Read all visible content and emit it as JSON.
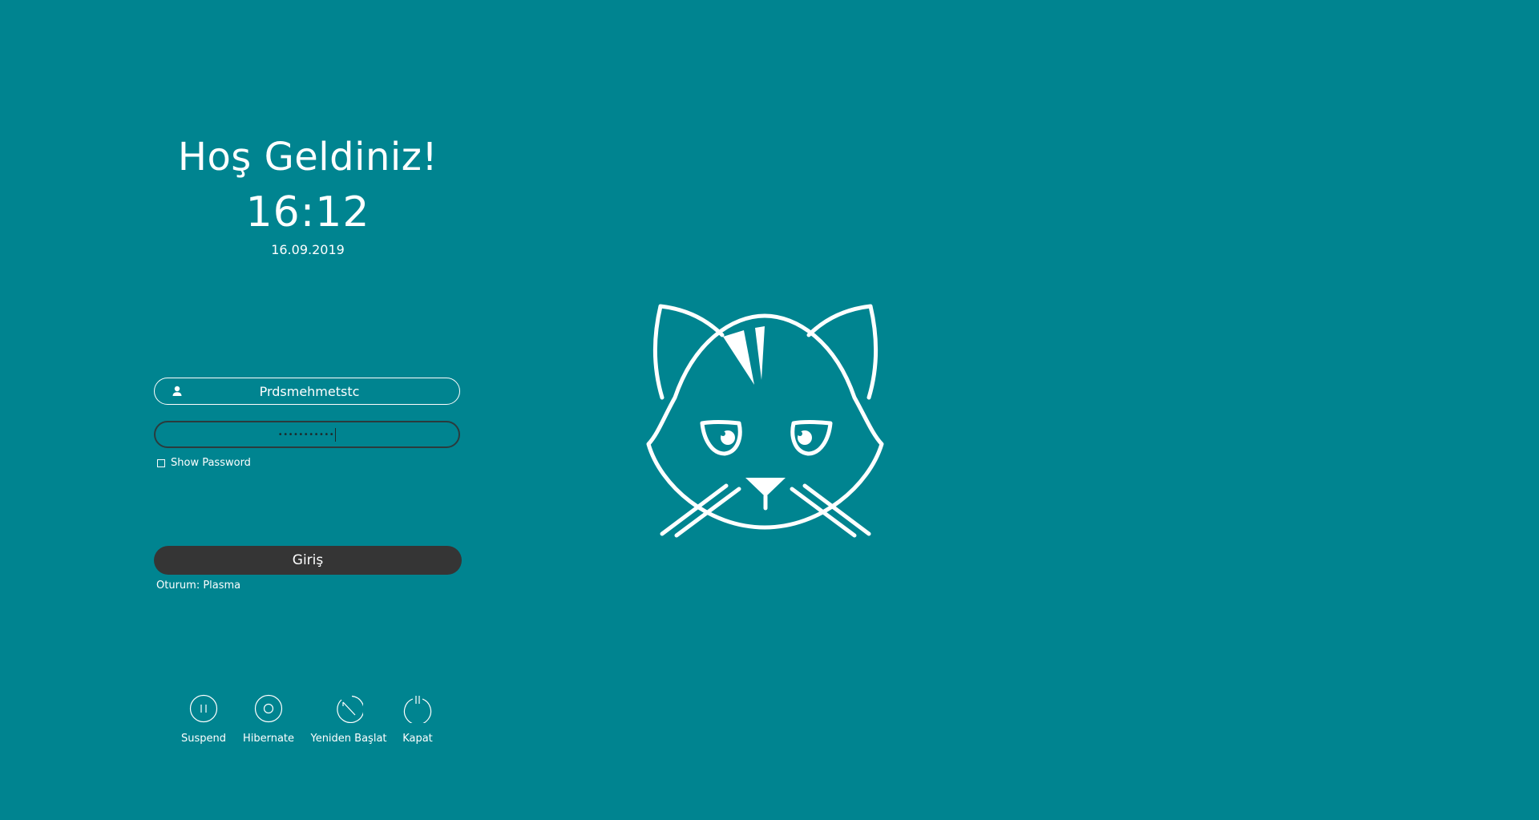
{
  "greeting": {
    "title": "Hoş Geldiniz!",
    "time": "16:12",
    "date": "16.09.2019"
  },
  "login": {
    "username": "Prdsmehmetstc",
    "password_mask": "•••••••••••",
    "show_password_label": "Show Password",
    "show_password_checked": false,
    "login_button_label": "Giriş",
    "session_label": "Oturum: Plasma"
  },
  "power_actions": [
    {
      "label": "Suspend",
      "icon": "suspend-icon"
    },
    {
      "label": "Hibernate",
      "icon": "hibernate-icon"
    },
    {
      "label": "Yeniden Başlat",
      "icon": "restart-icon"
    },
    {
      "label": "Kapat",
      "icon": "shutdown-icon"
    }
  ],
  "colors": {
    "background": "#008490",
    "text": "#ffffff",
    "button": "#353535"
  },
  "logo": {
    "icon": "cat-logo-icon"
  }
}
